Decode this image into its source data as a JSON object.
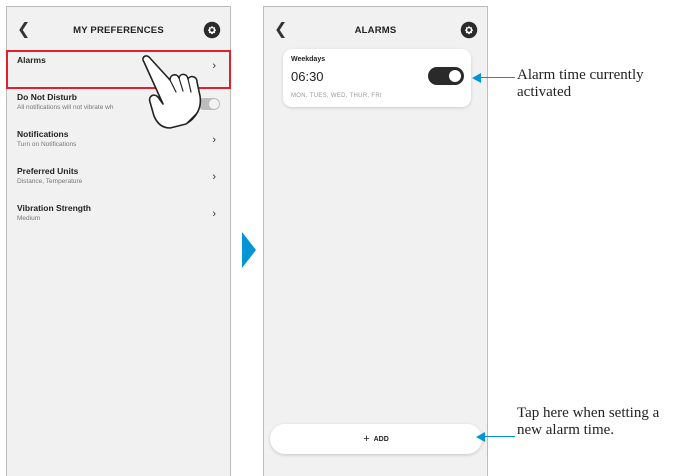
{
  "left_screen": {
    "title": "MY PREFERENCES",
    "items": [
      {
        "label": "Alarms",
        "sub": ""
      },
      {
        "label": "Do Not Disturb",
        "sub": "All notifications will not vibrate wh"
      },
      {
        "label": "Notifications",
        "sub": "Turn on Notifications"
      },
      {
        "label": "Preferred Units",
        "sub": "Distance, Temperature"
      },
      {
        "label": "Vibration Strength",
        "sub": "Medium"
      }
    ]
  },
  "right_screen": {
    "title": "ALARMS",
    "alarm": {
      "name": "Weekdays",
      "time": "06:30",
      "days": "MON, TUES, WED, THUR, FRI",
      "enabled": true
    },
    "add_label": "ADD",
    "add_icon": "+"
  },
  "callouts": {
    "alarm_active": "Alarm time currently activated",
    "add_hint": "Tap here when setting a new alarm time."
  },
  "colors": {
    "accent_arrow": "#0096d6",
    "highlight": "#e0202a",
    "toggle_on": "#2a2a2a"
  },
  "icons": [
    "back-chevron-icon",
    "gear-icon",
    "chevron-right-icon",
    "hand-pointer-icon",
    "plus-icon"
  ]
}
